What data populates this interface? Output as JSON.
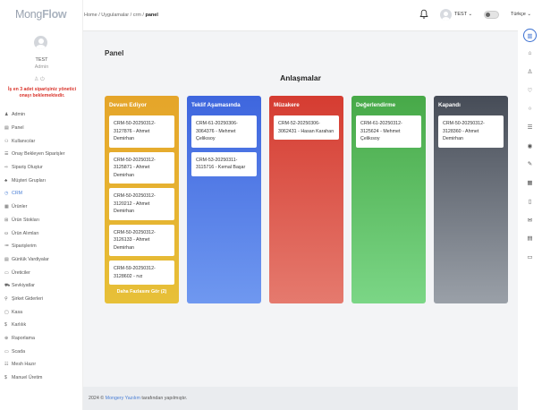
{
  "sidebar": {
    "logo_a": "Mong",
    "logo_b": "Flow",
    "user_name": "TEST",
    "user_role": "Admin",
    "user_icons": "♙ ⏻",
    "warning": "İş en 3 adet siparişiniz yönetici onayı beklemektedir.",
    "items": [
      {
        "icon": "♟",
        "label": "Admin"
      },
      {
        "icon": "▤",
        "label": "Panel"
      },
      {
        "icon": "⚇",
        "label": "Kullanıcılar"
      },
      {
        "icon": "☰",
        "label": "Onay Bekleyen Siparişler"
      },
      {
        "icon": "⇨",
        "label": "Sipariş Oluştur"
      },
      {
        "icon": "♣",
        "label": "Müşteri Grupları"
      },
      {
        "icon": "◷",
        "label": "CRM"
      },
      {
        "icon": "▦",
        "label": "Ürünler"
      },
      {
        "icon": "⊞",
        "label": "Ürün Stokları"
      },
      {
        "icon": "⛀",
        "label": "Ürün Alımları"
      },
      {
        "icon": "≔",
        "label": "Siparişlerim"
      },
      {
        "icon": "▤",
        "label": "Günlük Vardiyalar"
      },
      {
        "icon": "▭",
        "label": "Üreticiler"
      },
      {
        "icon": "⛟",
        "label": "Sevkiyatlar"
      },
      {
        "icon": "⚲",
        "label": "Şirket Giderleri"
      },
      {
        "icon": "▢",
        "label": "Kasa"
      },
      {
        "icon": "$",
        "label": "Karlılık"
      },
      {
        "icon": "⊕",
        "label": "Raporlama"
      },
      {
        "icon": "▭",
        "label": "Scada"
      },
      {
        "icon": "☷",
        "label": "Mesh Hazır"
      },
      {
        "icon": "$",
        "label": "Manuel Üretim"
      }
    ]
  },
  "topbar": {
    "breadcrumb": [
      "Home",
      "Uygulamalar",
      "crm"
    ],
    "breadcrumb_current": "panel",
    "user": "TEST",
    "language": "Türkçe"
  },
  "page_title": "Panel",
  "section_title": "Anlaşmalar",
  "columns": [
    {
      "title": "Devam Ediyor",
      "color": "#e5a52a",
      "cards": [
        "CRM-50-20250312-3127876 - Ahmet Demirhan",
        "CRM-50-20250312-3125871 - Ahmet Demirhan",
        "CRM-50-20250312-3120212 - Ahmet Demirhan",
        "CRM-50-20250312-3126133 - Ahmet Demirhan",
        "CRM-59-20250312-3128602 - rvz"
      ],
      "more": "Daha Fazlasını Gör (2)"
    },
    {
      "title": "Teklif Aşamasında",
      "color": "#3e66de",
      "cards": [
        "CRM-61-20250306-3064376 - Mehmet Çelikısoy",
        "CRM-53-20250311-3115716 - Kemal Başar"
      ]
    },
    {
      "title": "Müzakere",
      "color": "#d53c31",
      "cards": [
        "CRM-52-20250306-3062431 - Hasan Karahan"
      ]
    },
    {
      "title": "Değerlendirme",
      "color": "#47a948",
      "cards": [
        "CRM-61-20250312-3125624 - Mehmet Çelikısoy"
      ]
    },
    {
      "title": "Kapandı",
      "color": "#464c57",
      "cards": [
        "CRM-50-20250312-3128360 - Ahmet Demirhan"
      ]
    }
  ],
  "footer": {
    "prefix": "2024 ©",
    "brand": "Mongery Yazılım",
    "suffix": "tarafından yapılmıştır."
  },
  "rightbar_icons": [
    "layout-icon",
    "bank-icon",
    "user-icon",
    "heart-icon",
    "circle-icon",
    "sliders-icon",
    "coin-icon",
    "pen-icon",
    "calendar-icon",
    "tablet-icon",
    "mail-icon",
    "grid-icon",
    "document-icon"
  ]
}
